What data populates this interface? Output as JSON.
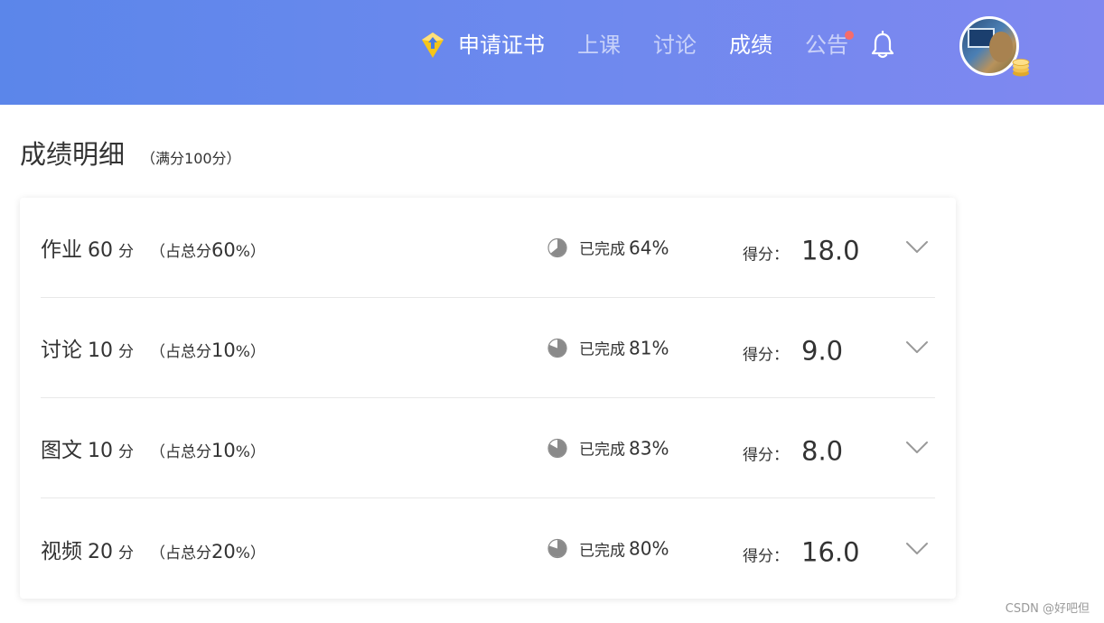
{
  "header": {
    "nav": [
      {
        "label": "申请证书",
        "state": "highlight",
        "icon": "certificate-badge-icon"
      },
      {
        "label": "上课",
        "state": "normal"
      },
      {
        "label": "讨论",
        "state": "normal"
      },
      {
        "label": "成绩",
        "state": "active"
      },
      {
        "label": "公告",
        "state": "normal",
        "badge_dot": true
      }
    ],
    "icons": [
      "bell-icon",
      "avatar",
      "coin-icon"
    ],
    "colors": {
      "gradient_start": "#5b86ea",
      "gradient_end": "#8088f0",
      "notice_dot": "#f56c6c"
    }
  },
  "page": {
    "title": "成绩明细",
    "subtitle": "（满分100分）"
  },
  "grades": [
    {
      "name": "作业",
      "score": "60",
      "unit": "分",
      "weight_prefix": "（占总分",
      "weight": "60",
      "weight_suffix": "%）",
      "progress_label": "已完成",
      "progress": "64%",
      "progress_fraction": 0.64,
      "score_label": "得分：",
      "earned": "18.0"
    },
    {
      "name": "讨论",
      "score": "10",
      "unit": "分",
      "weight_prefix": "（占总分",
      "weight": "10",
      "weight_suffix": "%）",
      "progress_label": "已完成",
      "progress": "81%",
      "progress_fraction": 0.81,
      "score_label": "得分：",
      "earned": "9.0"
    },
    {
      "name": "图文",
      "score": "10",
      "unit": "分",
      "weight_prefix": "（占总分",
      "weight": "10",
      "weight_suffix": "%）",
      "progress_label": "已完成",
      "progress": "83%",
      "progress_fraction": 0.83,
      "score_label": "得分：",
      "earned": "8.0"
    },
    {
      "name": "视频",
      "score": "20",
      "unit": "分",
      "weight_prefix": "（占总分",
      "weight": "20",
      "weight_suffix": "%）",
      "progress_label": "已完成",
      "progress": "80%",
      "progress_fraction": 0.8,
      "score_label": "得分：",
      "earned": "16.0"
    }
  ],
  "watermark": "CSDN @好吧但"
}
